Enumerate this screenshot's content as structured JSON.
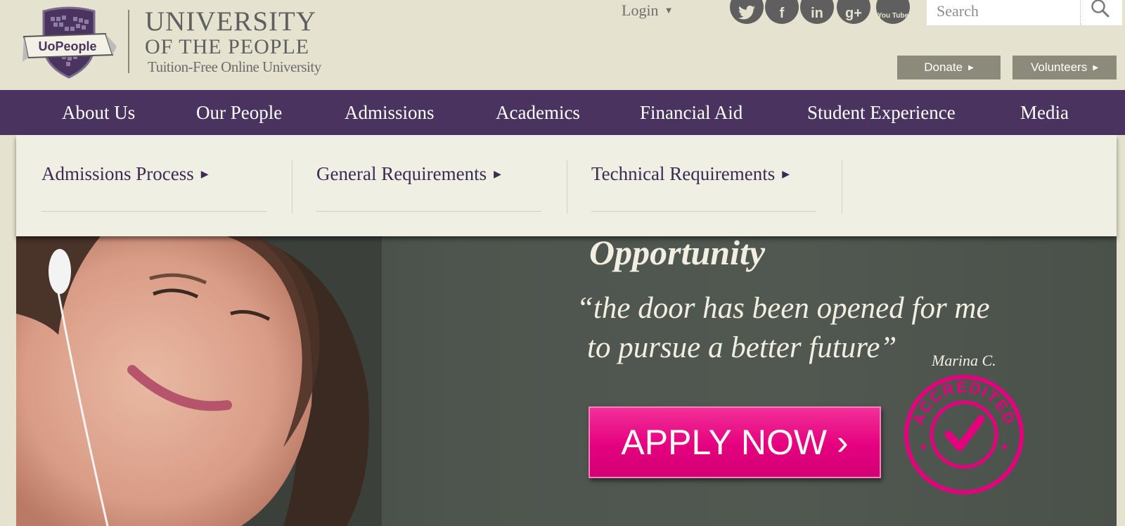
{
  "brand": {
    "badge_text": "UoPeople",
    "name_line1": "UNIVERSITY",
    "name_line2": "OF THE PEOPLE",
    "tagline": "Tuition-Free Online University"
  },
  "header": {
    "login_label": "Login",
    "social": [
      {
        "name": "twitter",
        "icon": "twitter-icon"
      },
      {
        "name": "facebook",
        "icon": "facebook-icon",
        "glyph": "f"
      },
      {
        "name": "linkedin",
        "icon": "linkedin-icon",
        "glyph": "in"
      },
      {
        "name": "google-plus",
        "icon": "google-plus-icon",
        "glyph": "g+"
      },
      {
        "name": "youtube",
        "icon": "youtube-icon",
        "glyph": "You Tube"
      }
    ],
    "search": {
      "placeholder": "Search",
      "value": ""
    },
    "buttons": {
      "donate": "Donate",
      "volunteers": "Volunteers"
    }
  },
  "nav": {
    "items": [
      "About Us",
      "Our People",
      "Admissions",
      "Academics",
      "Financial Aid",
      "Student Experience",
      "Media"
    ],
    "active": "Admissions"
  },
  "dropdown": {
    "items": [
      "Admissions Process",
      "General Requirements",
      "Technical Requirements"
    ]
  },
  "hero": {
    "heading": "Opportunity",
    "quote_line1": "“the door has been opened for me",
    "quote_line2": "to pursue a better future”",
    "author": "Marina C.",
    "cta_label": "APPLY NOW ›",
    "seal_text": "ACCREDITED"
  },
  "colors": {
    "page_bg": "#e5e3cf",
    "nav_purple": "#4a345f",
    "dropdown_bg": "#f0efe3",
    "cta_pink": "#e5007e",
    "gray_button": "#8b8a7b",
    "icon_gray": "#5f5f5f"
  }
}
